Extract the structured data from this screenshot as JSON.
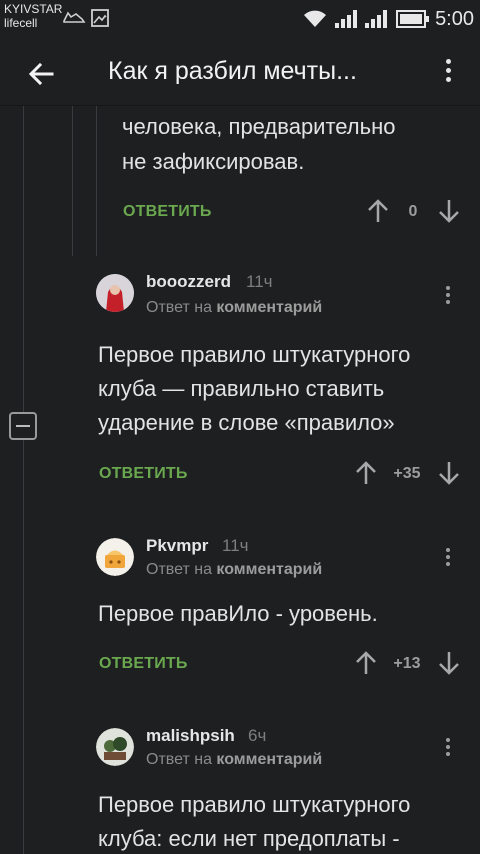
{
  "status_bar": {
    "carrier_1": "KYIVSTAR",
    "carrier_2": "lifecell",
    "time": "5:00"
  },
  "toolbar": {
    "title": "Как я разбил мечты..."
  },
  "comments": [
    {
      "text_line_1": "человека, предварительно",
      "text_line_2": "не зафиксировав.",
      "reply_label": "ОТВЕТИТЬ",
      "score": "0"
    },
    {
      "author": "booozzerd",
      "time": "11ч",
      "reply_prefix": "Ответ на",
      "reply_target": "комментарий",
      "text_line_1": "Первое правило штукатурного",
      "text_line_2": "клуба — правильно ставить",
      "text_line_3": "ударение в слове «правило»",
      "reply_label": "ОТВЕТИТЬ",
      "score": "+35"
    },
    {
      "author": "Pkvmpr",
      "time": "11ч",
      "reply_prefix": "Ответ на",
      "reply_target": "комментарий",
      "text_line_1": "Первое правИло - уровень.",
      "reply_label": "ОТВЕТИТЬ",
      "score": "+13"
    },
    {
      "author": "malishpsih",
      "time": "6ч",
      "reply_prefix": "Ответ на",
      "reply_target": "комментарий",
      "text_line_1": "Первое правило штукатурного",
      "text_line_2": "клуба: если нет предоплаты -"
    }
  ],
  "colors": {
    "background": "#1e1f21",
    "reply_green": "#6aa84f",
    "text": "#e3e3e3",
    "muted": "#8a8a8a"
  }
}
